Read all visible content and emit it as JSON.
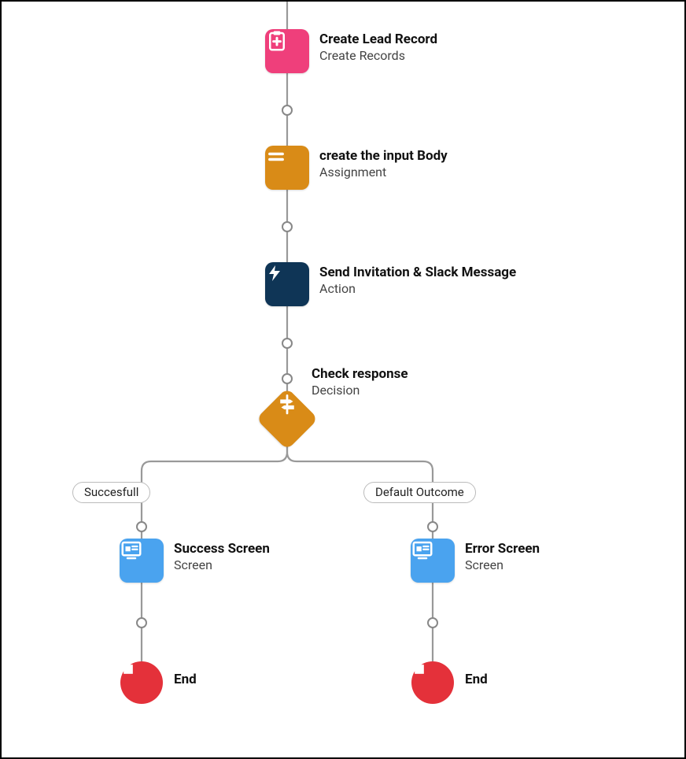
{
  "colors": {
    "pink": "#ef3f7b",
    "orange": "#d98b17",
    "navy": "#0f3556",
    "blue": "#4aa3ef",
    "red": "#e4313a",
    "line": "#999999"
  },
  "nodes": {
    "createLead": {
      "title": "Create Lead Record",
      "subtitle": "Create Records"
    },
    "createBody": {
      "title": "create the input Body",
      "subtitle": "Assignment"
    },
    "sendInvite": {
      "title": "Send Invitation & Slack Message",
      "subtitle": "Action"
    },
    "checkResp": {
      "title": "Check response",
      "subtitle": "Decision"
    },
    "successScreen": {
      "title": "Success Screen",
      "subtitle": "Screen"
    },
    "errorScreen": {
      "title": "Error Screen",
      "subtitle": "Screen"
    },
    "endLeft": {
      "title": "End"
    },
    "endRight": {
      "title": "End"
    }
  },
  "branches": {
    "left": "Succesfull",
    "right": "Default Outcome"
  }
}
